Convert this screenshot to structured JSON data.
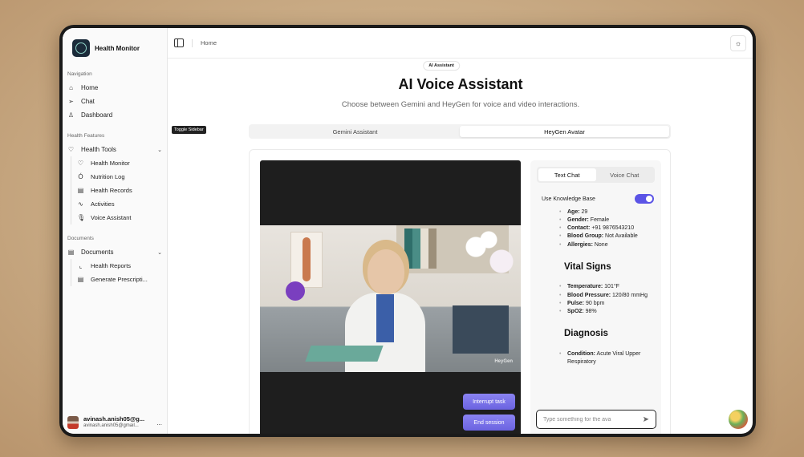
{
  "app": {
    "name": "Health Monitor"
  },
  "sidebar": {
    "sections": [
      {
        "label": "Navigation"
      },
      {
        "label": "Health Features"
      },
      {
        "label": "Documents"
      }
    ],
    "nav": [
      {
        "label": "Home",
        "icon": "home-icon"
      },
      {
        "label": "Chat",
        "icon": "send-icon"
      },
      {
        "label": "Dashboard",
        "icon": "user-icon"
      }
    ],
    "health_tools": {
      "label": "Health Tools",
      "items": [
        "Health Monitor",
        "Nutrition Log",
        "Health Records",
        "Activities",
        "Voice Assistant"
      ]
    },
    "documents": {
      "label": "Documents",
      "items": [
        "Health Reports",
        "Generate Prescripti..."
      ]
    },
    "user": {
      "name": "avinash.anish05@g...",
      "email": "avinash.anish05@gmail...",
      "more": "..."
    }
  },
  "topbar": {
    "breadcrumb": "Home",
    "tooltip": "Toggle Sidebar"
  },
  "page": {
    "badge": "AI Assistant",
    "title": "AI Voice Assistant",
    "subtitle": "Choose between Gemini and HeyGen for voice and video interactions.",
    "tabs": [
      "Gemini Assistant",
      "HeyGen Avatar"
    ],
    "active_tab": "HeyGen Avatar"
  },
  "video": {
    "watermark": "HeyGen",
    "interrupt_label": "Interrupt task",
    "end_label": "End session"
  },
  "chat_panel": {
    "tabs": [
      "Text Chat",
      "Voice Chat"
    ],
    "active_tab": "Text Chat",
    "knowledge_base_label": "Use Knowledge Base",
    "knowledge_base_on": true,
    "personal": [
      {
        "k": "Age:",
        "v": " 29"
      },
      {
        "k": "Gender:",
        "v": " Female"
      },
      {
        "k": "Contact:",
        "v": " +91 9876543210"
      },
      {
        "k": "Blood Group:",
        "v": " Not Available"
      },
      {
        "k": "Allergies:",
        "v": " None"
      }
    ],
    "vitals_heading": "Vital Signs",
    "vitals": [
      {
        "k": "Temperature:",
        "v": " 101°F"
      },
      {
        "k": "Blood Pressure:",
        "v": " 120/80 mmHg"
      },
      {
        "k": "Pulse:",
        "v": " 90 bpm"
      },
      {
        "k": "SpO2:",
        "v": " 98%"
      }
    ],
    "diagnosis_heading": "Diagnosis",
    "diagnosis": [
      {
        "k": "Condition:",
        "v": " Acute Viral Upper Respiratory"
      }
    ],
    "input_placeholder": "Type something for the ava"
  },
  "colors": {
    "accent": "#5b54e6",
    "button": "#7a72ea"
  }
}
